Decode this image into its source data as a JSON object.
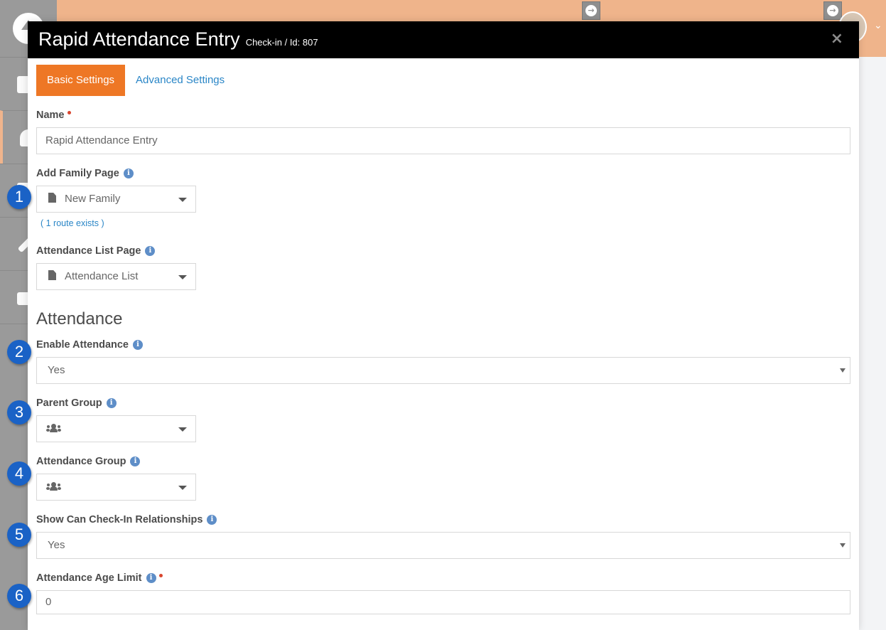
{
  "modal": {
    "title": "Rapid Attendance Entry",
    "subtitle": "Check-in / Id: 807",
    "close_label": "×"
  },
  "tabs": [
    {
      "label": "Basic Settings",
      "active": true
    },
    {
      "label": "Advanced Settings",
      "active": false
    }
  ],
  "fields": {
    "name": {
      "label": "Name",
      "value": "Rapid Attendance Entry",
      "required": true
    },
    "add_family_page": {
      "label": "Add Family Page",
      "value": "New Family",
      "route_note": "( 1 route exists )"
    },
    "attendance_list_page": {
      "label": "Attendance List Page",
      "value": "Attendance List"
    },
    "enable_attendance": {
      "label": "Enable Attendance",
      "value": "Yes"
    },
    "parent_group": {
      "label": "Parent Group",
      "value": ""
    },
    "attendance_group": {
      "label": "Attendance Group",
      "value": ""
    },
    "show_can_checkin": {
      "label": "Show Can Check-In Relationships",
      "value": "Yes"
    },
    "attendance_age_limit": {
      "label": "Attendance Age Limit",
      "value": "0",
      "required": true
    }
  },
  "section": {
    "attendance_title": "Attendance"
  },
  "badges": [
    "1",
    "2",
    "3",
    "4",
    "5",
    "6"
  ],
  "colors": {
    "accent": "#ee7725",
    "header_bg": "#efb48b",
    "link": "#2a86c7",
    "badge": "#1a62c6",
    "required": "#d9452e",
    "info": "#5e8ec8"
  },
  "icons": {
    "header_button": "arrow-circle-right-icon",
    "page_picker": "file-icon",
    "group_picker": "users-icon",
    "info": "info-circle-icon"
  }
}
